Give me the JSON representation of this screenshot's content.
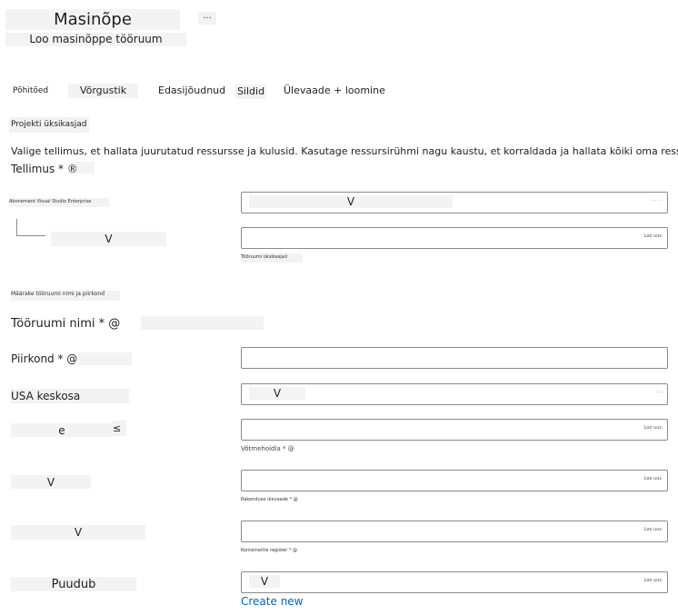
{
  "header": {
    "title": "Masinõpe",
    "subtitle": "Loo masinõppe tööruum",
    "more": "..."
  },
  "tabs": [
    {
      "label": "Põhitõed",
      "active": true
    },
    {
      "label": "Võrgustik"
    },
    {
      "label": "Edasijõudnud"
    },
    {
      "label": "Sildid"
    },
    {
      "label": "Ülevaade + loomine"
    }
  ],
  "project": {
    "heading": "Projekti üksikasjad",
    "description": "Valige tellimus, et hallata juurutatud ressursse ja kulusid. Kasutage ressursirühmi nagu kaustu, et korraldada ja hallata kõiki oma ressursse.",
    "subscription_label": "Tellimus * ®",
    "subscription_name": "Abonement Visual Studio Enterprise",
    "subscription_value": "V",
    "subscription_end": "· · · ·",
    "resource_group_value": "V",
    "resource_group_end": "Loo uus",
    "resource_group_help": "Tööruumi üksikasjad"
  },
  "workspace": {
    "heading": "Määrake tööruumi nimi ja piirkond",
    "name_label": "Tööruumi nimi * @",
    "region_label": "Piirkond * @",
    "region_value": "USA keskosa",
    "region_select": "V",
    "region_end": "- -",
    "storage_label": "e",
    "storage_mark": "≤",
    "storage_end": "Loo uus",
    "keyvault_help": "Võtmehoidla * @",
    "keyvault_label": "V",
    "keyvault_end": "Loo uus",
    "appinsights_help": "Rakenduse ülevaade * @",
    "appinsights_label": "V",
    "appinsights_end": "Loo uus",
    "registry_help": "Konteinerite register * @",
    "registry_label": "Puudub",
    "registry_select": "V",
    "registry_end": "Loo uus",
    "create_new": "Create new"
  },
  "colors": {
    "link": "#0067b8",
    "border": "#8a8a8a",
    "patch": "#f3f3f3"
  }
}
